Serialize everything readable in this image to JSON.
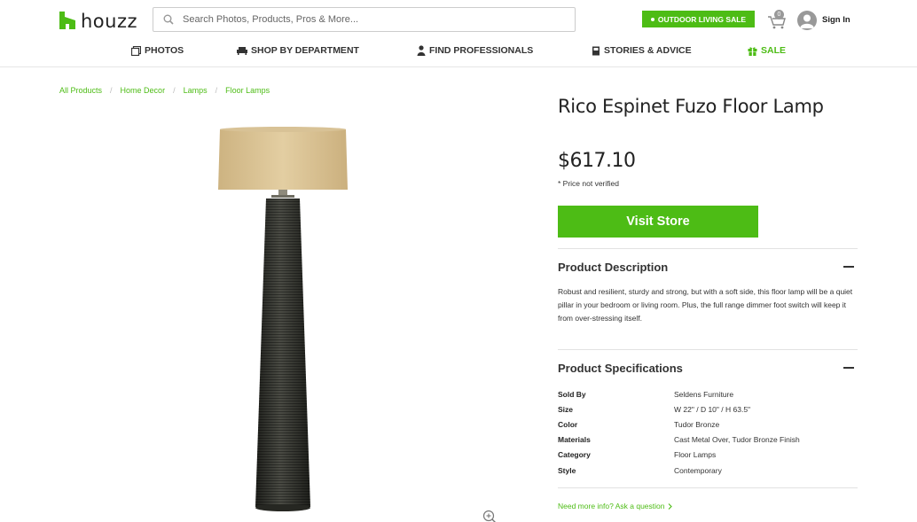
{
  "header": {
    "logo_text": "houzz",
    "search_placeholder": "Search Photos, Products, Pros & More...",
    "promo_label": "OUTDOOR LIVING SALE",
    "cart_count": "0",
    "signin_label": "Sign In"
  },
  "nav": {
    "items": [
      {
        "label": "PHOTOS",
        "icon": "photos-icon"
      },
      {
        "label": "SHOP BY DEPARTMENT",
        "icon": "sofa-icon"
      },
      {
        "label": "FIND PROFESSIONALS",
        "icon": "person-icon"
      },
      {
        "label": "STORIES & ADVICE",
        "icon": "book-icon"
      },
      {
        "label": "SALE",
        "icon": "gift-icon"
      }
    ]
  },
  "breadcrumb": [
    "All Products",
    "Home Decor",
    "Lamps",
    "Floor Lamps"
  ],
  "product": {
    "title": "Rico Espinet Fuzo Floor Lamp",
    "price": "$617.10",
    "price_note": "* Price not verified",
    "visit_label": "Visit Store",
    "description_title": "Product Description",
    "description": "Robust and resilient, sturdy and strong, but with a soft side, this floor lamp will be a quiet pillar in your bedroom or living room. Plus, the full range dimmer foot switch will keep it from over-stressing itself.",
    "specs_title": "Product Specifications",
    "specs": [
      {
        "key": "Sold By",
        "value": "Seldens Furniture"
      },
      {
        "key": "Size",
        "value": "W 22\" / D 10\" / H 63.5\""
      },
      {
        "key": "Color",
        "value": "Tudor Bronze"
      },
      {
        "key": "Materials",
        "value": "Cast Metal Over, Tudor Bronze Finish"
      },
      {
        "key": "Category",
        "value": "Floor Lamps"
      },
      {
        "key": "Style",
        "value": "Contemporary"
      }
    ],
    "more_info_label": "Need more info? Ask a question"
  },
  "colors": {
    "brand_green": "#4dbc15",
    "lampshade": "#ddc595",
    "lamp_base": "#2e2f2a"
  }
}
